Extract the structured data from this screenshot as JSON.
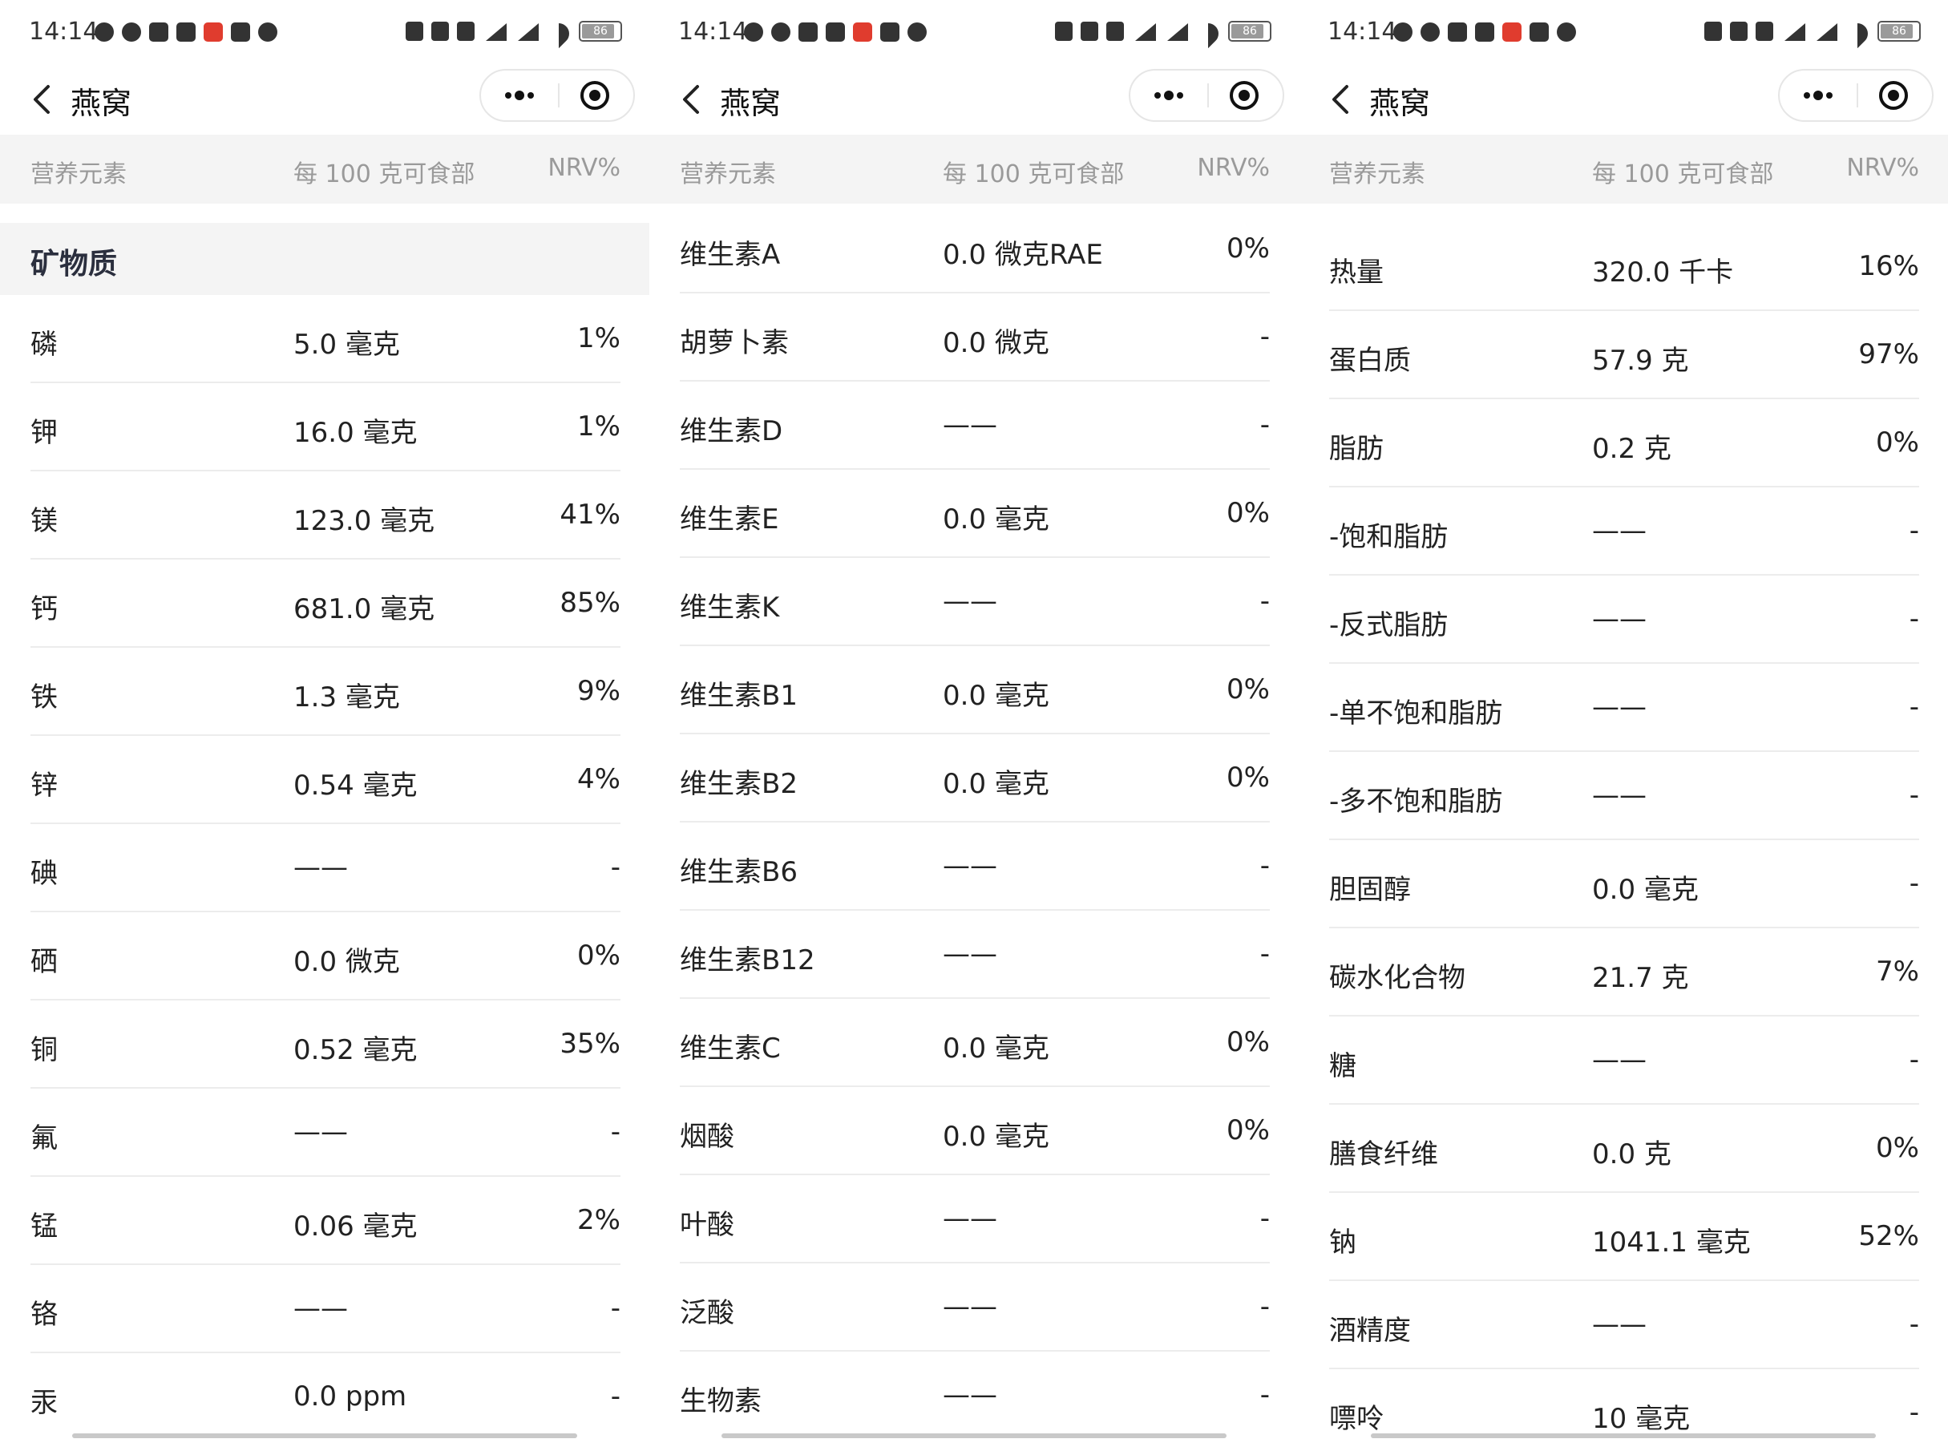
{
  "panels": [
    {
      "status": {
        "time": "14:14",
        "battery": "86"
      },
      "nav": {
        "title": "燕窝"
      },
      "header": {
        "name": "营养元素",
        "value": "每 100 克可食部",
        "nrv": "NRV%"
      },
      "section_title": "矿物质",
      "rows": [
        {
          "name": "磷",
          "value": "5.0 毫克",
          "nrv": "1%"
        },
        {
          "name": "钾",
          "value": "16.0 毫克",
          "nrv": "1%"
        },
        {
          "name": "镁",
          "value": "123.0 毫克",
          "nrv": "41%"
        },
        {
          "name": "钙",
          "value": "681.0 毫克",
          "nrv": "85%"
        },
        {
          "name": "铁",
          "value": "1.3 毫克",
          "nrv": "9%"
        },
        {
          "name": "锌",
          "value": "0.54 毫克",
          "nrv": "4%"
        },
        {
          "name": "碘",
          "value": "——",
          "nrv": "-"
        },
        {
          "name": "硒",
          "value": "0.0 微克",
          "nrv": "0%"
        },
        {
          "name": "铜",
          "value": "0.52 毫克",
          "nrv": "35%"
        },
        {
          "name": "氟",
          "value": "——",
          "nrv": "-"
        },
        {
          "name": "锰",
          "value": "0.06 毫克",
          "nrv": "2%"
        },
        {
          "name": "铬",
          "value": "——",
          "nrv": "-"
        },
        {
          "name": "汞",
          "value": "0.0 ppm",
          "nrv": "-"
        }
      ]
    },
    {
      "status": {
        "time": "14:14",
        "battery": "86"
      },
      "nav": {
        "title": "燕窝"
      },
      "header": {
        "name": "营养元素",
        "value": "每 100 克可食部",
        "nrv": "NRV%"
      },
      "rows": [
        {
          "name": "维生素A",
          "value": "0.0 微克RAE",
          "nrv": "0%"
        },
        {
          "name": "胡萝卜素",
          "value": "0.0 微克",
          "nrv": "-"
        },
        {
          "name": "维生素D",
          "value": "——",
          "nrv": "-"
        },
        {
          "name": "维生素E",
          "value": "0.0 毫克",
          "nrv": "0%"
        },
        {
          "name": "维生素K",
          "value": "——",
          "nrv": "-"
        },
        {
          "name": "维生素B1",
          "value": "0.0 毫克",
          "nrv": "0%"
        },
        {
          "name": "维生素B2",
          "value": "0.0 毫克",
          "nrv": "0%"
        },
        {
          "name": "维生素B6",
          "value": "——",
          "nrv": "-"
        },
        {
          "name": "维生素B12",
          "value": "——",
          "nrv": "-"
        },
        {
          "name": "维生素C",
          "value": "0.0 毫克",
          "nrv": "0%"
        },
        {
          "name": "烟酸",
          "value": "0.0 毫克",
          "nrv": "0%"
        },
        {
          "name": "叶酸",
          "value": "——",
          "nrv": "-"
        },
        {
          "name": "泛酸",
          "value": "——",
          "nrv": "-"
        },
        {
          "name": "生物素",
          "value": "——",
          "nrv": "-"
        }
      ]
    },
    {
      "status": {
        "time": "14:14",
        "battery": "86"
      },
      "nav": {
        "title": "燕窝"
      },
      "header": {
        "name": "营养元素",
        "value": "每 100 克可食部",
        "nrv": "NRV%"
      },
      "rows": [
        {
          "name": "热量",
          "value": "320.0 千卡",
          "nrv": "16%"
        },
        {
          "name": "蛋白质",
          "value": "57.9 克",
          "nrv": "97%"
        },
        {
          "name": "脂肪",
          "value": "0.2 克",
          "nrv": "0%"
        },
        {
          "name": "-饱和脂肪",
          "value": "——",
          "nrv": "-"
        },
        {
          "name": "-反式脂肪",
          "value": "——",
          "nrv": "-"
        },
        {
          "name": "-单不饱和脂肪",
          "value": "——",
          "nrv": "-"
        },
        {
          "name": "-多不饱和脂肪",
          "value": "——",
          "nrv": "-"
        },
        {
          "name": "胆固醇",
          "value": "0.0 毫克",
          "nrv": "-"
        },
        {
          "name": "碳水化合物",
          "value": "21.7 克",
          "nrv": "7%"
        },
        {
          "name": "糖",
          "value": "——",
          "nrv": "-"
        },
        {
          "name": "膳食纤维",
          "value": "0.0 克",
          "nrv": "0%"
        },
        {
          "name": "钠",
          "value": "1041.1 毫克",
          "nrv": "52%"
        },
        {
          "name": "酒精度",
          "value": "——",
          "nrv": "-"
        },
        {
          "name": "嘌呤",
          "value": "10 毫克",
          "nrv": "-"
        }
      ]
    }
  ]
}
